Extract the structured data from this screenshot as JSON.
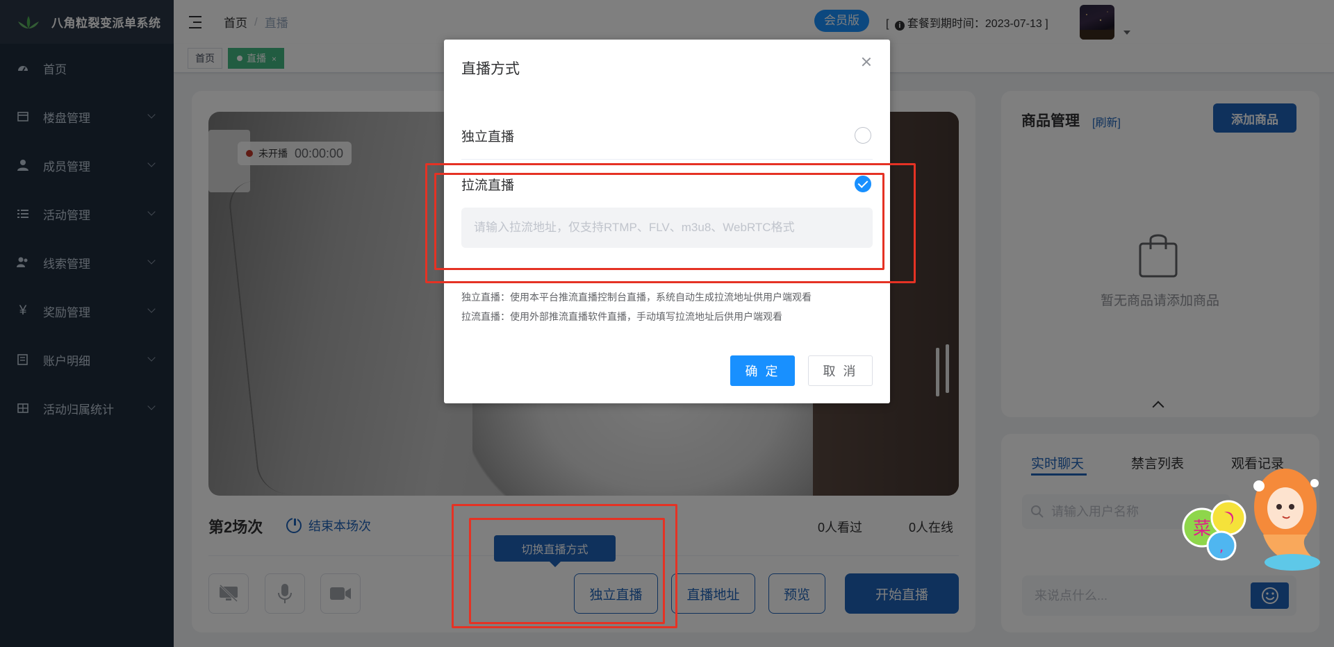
{
  "app": {
    "title": "八角粒裂变派单系统"
  },
  "sidebar": {
    "items": [
      {
        "label": "首页",
        "icon": "dashboard-icon",
        "has_children": false
      },
      {
        "label": "楼盘管理",
        "icon": "building-icon",
        "has_children": true
      },
      {
        "label": "成员管理",
        "icon": "user-icon",
        "has_children": true
      },
      {
        "label": "活动管理",
        "icon": "list-icon",
        "has_children": true
      },
      {
        "label": "线索管理",
        "icon": "users-icon",
        "has_children": true
      },
      {
        "label": "奖励管理",
        "icon": "yen-icon",
        "has_children": true
      },
      {
        "label": "账户明细",
        "icon": "ledger-icon",
        "has_children": true
      },
      {
        "label": "活动归属统计",
        "icon": "table-icon",
        "has_children": true
      }
    ]
  },
  "header": {
    "breadcrumb": [
      "首页",
      "直播"
    ],
    "breadcrumb_sep": "/",
    "member_badge": "会员版",
    "expire_open": "[",
    "expire_label": "套餐到期时间：2023-07-13",
    "expire_close": "]"
  },
  "tags": [
    {
      "label": "首页",
      "active": false
    },
    {
      "label": "直播",
      "active": true,
      "close": "×"
    }
  ],
  "live": {
    "status_label": "未开播",
    "timer": "00:00:00",
    "session_title": "第2场次",
    "end_session": "结束本场次",
    "viewed": "0人看过",
    "online": "0人在线",
    "tooltip": "切换直播方式",
    "buttons": {
      "mode": "独立直播",
      "address": "直播地址",
      "preview": "预览",
      "start": "开始直播"
    }
  },
  "goods": {
    "title": "商品管理",
    "refresh": "[刷新]",
    "add": "添加商品",
    "empty": "暂无商品请添加商品"
  },
  "chat": {
    "tabs": [
      "实时聊天",
      "禁言列表",
      "观看记录"
    ],
    "active_tab": 0,
    "search_placeholder": "请输入用户名称",
    "message_placeholder": "来说点什么..."
  },
  "modal": {
    "title": "直播方式",
    "options": [
      {
        "label": "独立直播",
        "checked": false
      },
      {
        "label": "拉流直播",
        "checked": true
      }
    ],
    "pull_placeholder": "请输入拉流地址，仅支持RTMP、FLV、m3u8、WebRTC格式",
    "help": [
      "独立直播：使用本平台推流直播控制台直播，系统自动生成拉流地址供用户端观看",
      "拉流直播：使用外部推流直播软件直播，手动填写拉流地址后供用户端观看"
    ],
    "confirm": "确 定",
    "cancel": "取 消"
  },
  "colors": {
    "sidebar_bg": "#1f2d3d",
    "primary": "#1890ff",
    "brand_blue": "#1e62b8",
    "tag_green": "#42b983",
    "annotation_red": "#e53224"
  },
  "mascot": {
    "glyph": "菜"
  }
}
